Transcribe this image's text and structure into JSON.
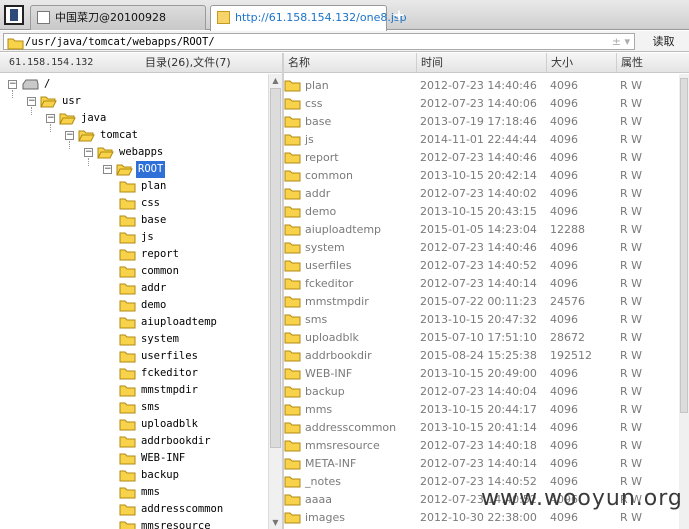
{
  "tabs": [
    {
      "label": "中国菜刀@20100928"
    },
    {
      "label": "http://61.158.154.132/one8.jsp"
    }
  ],
  "new_tab_symbol": "+",
  "address": {
    "path": "/usr/java/tomcat/webapps/ROOT/",
    "control_symbols": "± ▾"
  },
  "read_button": "读取",
  "left_header": {
    "ip": "61.158.154.132",
    "counts": "目录(26),文件(7)"
  },
  "tree": {
    "root": "/",
    "path_nodes": [
      "usr",
      "java",
      "tomcat",
      "webapps",
      "ROOT"
    ],
    "children": [
      "plan",
      "css",
      "base",
      "js",
      "report",
      "common",
      "addr",
      "demo",
      "aiuploadtemp",
      "system",
      "userfiles",
      "fckeditor",
      "mmstmpdir",
      "sms",
      "uploadblk",
      "addrbookdir",
      "WEB-INF",
      "backup",
      "mms",
      "addresscommon",
      "mmsresource"
    ]
  },
  "columns": {
    "name": "名称",
    "time": "时间",
    "size": "大小",
    "attr": "属性"
  },
  "files": [
    {
      "name": "plan",
      "time": "2012-07-23 14:40:46",
      "size": "4096",
      "attr": "R W"
    },
    {
      "name": "css",
      "time": "2012-07-23 14:40:06",
      "size": "4096",
      "attr": "R W"
    },
    {
      "name": "base",
      "time": "2013-07-19 17:18:46",
      "size": "4096",
      "attr": "R W"
    },
    {
      "name": "js",
      "time": "2014-11-01 22:44:44",
      "size": "4096",
      "attr": "R W"
    },
    {
      "name": "report",
      "time": "2012-07-23 14:40:46",
      "size": "4096",
      "attr": "R W"
    },
    {
      "name": "common",
      "time": "2013-10-15 20:42:14",
      "size": "4096",
      "attr": "R W"
    },
    {
      "name": "addr",
      "time": "2012-07-23 14:40:02",
      "size": "4096",
      "attr": "R W"
    },
    {
      "name": "demo",
      "time": "2013-10-15 20:43:15",
      "size": "4096",
      "attr": "R W"
    },
    {
      "name": "aiuploadtemp",
      "time": "2015-01-05 14:23:04",
      "size": "12288",
      "attr": "R W"
    },
    {
      "name": "system",
      "time": "2012-07-23 14:40:46",
      "size": "4096",
      "attr": "R W"
    },
    {
      "name": "userfiles",
      "time": "2012-07-23 14:40:52",
      "size": "4096",
      "attr": "R W"
    },
    {
      "name": "fckeditor",
      "time": "2012-07-23 14:40:14",
      "size": "4096",
      "attr": "R W"
    },
    {
      "name": "mmstmpdir",
      "time": "2015-07-22 00:11:23",
      "size": "24576",
      "attr": "R W"
    },
    {
      "name": "sms",
      "time": "2013-10-15 20:47:32",
      "size": "4096",
      "attr": "R W"
    },
    {
      "name": "uploadblk",
      "time": "2015-07-10 17:51:10",
      "size": "28672",
      "attr": "R W"
    },
    {
      "name": "addrbookdir",
      "time": "2015-08-24 15:25:38",
      "size": "192512",
      "attr": "R W"
    },
    {
      "name": "WEB-INF",
      "time": "2013-10-15 20:49:00",
      "size": "4096",
      "attr": "R W"
    },
    {
      "name": "backup",
      "time": "2012-07-23 14:40:04",
      "size": "4096",
      "attr": "R W"
    },
    {
      "name": "mms",
      "time": "2013-10-15 20:44:17",
      "size": "4096",
      "attr": "R W"
    },
    {
      "name": "addresscommon",
      "time": "2013-10-15 20:41:14",
      "size": "4096",
      "attr": "R W"
    },
    {
      "name": "mmsresource",
      "time": "2012-07-23 14:40:18",
      "size": "4096",
      "attr": "R W"
    },
    {
      "name": "META-INF",
      "time": "2012-07-23 14:40:14",
      "size": "4096",
      "attr": "R W"
    },
    {
      "name": "_notes",
      "time": "2012-07-23 14:40:52",
      "size": "4096",
      "attr": "R W"
    },
    {
      "name": "aaaa",
      "time": "2012-07-23 14:40:52",
      "size": "4096",
      "attr": "R W"
    },
    {
      "name": "images",
      "time": "2012-10-30 22:38:00",
      "size": "4096",
      "attr": "R W"
    }
  ],
  "watermark": "www.wooyun.org",
  "colors": {
    "folder_fill": "#f7d24a",
    "folder_stroke": "#b08a10",
    "selection": "#2f6fd8",
    "url_tab_text": "#1a73c9"
  }
}
